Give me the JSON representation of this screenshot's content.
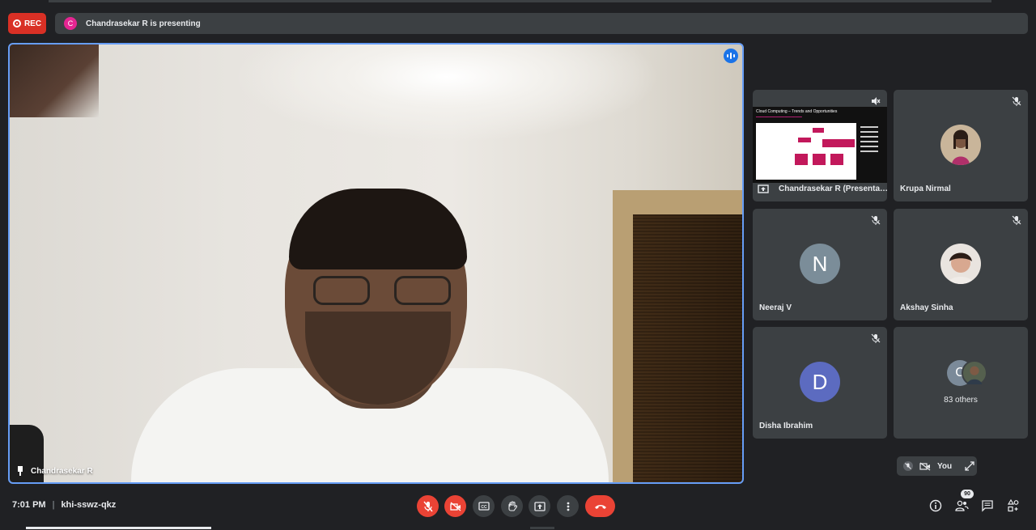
{
  "recording": {
    "label": "REC",
    "color": "#d93025"
  },
  "presenting_bar": {
    "avatar_letter": "C",
    "text": "Chandrasekar R is presenting"
  },
  "main_video": {
    "participant": "Chandrasekar R",
    "speaking": true
  },
  "tiles": [
    {
      "name": "Chandrasekar R (Presenta…",
      "type": "presentation",
      "slide_title": "Cloud Computing – Trends and Opportunities"
    },
    {
      "name": "Krupa Nirmal",
      "type": "photo"
    },
    {
      "name": "Neeraj V",
      "type": "letter",
      "letter": "N",
      "color": "#7b8d99"
    },
    {
      "name": "Akshay Sinha",
      "type": "photo"
    },
    {
      "name": "Disha Ibrahim",
      "type": "letter",
      "letter": "D",
      "color": "#5c6bc0"
    },
    {
      "name": "83 others",
      "type": "others",
      "letter": "C"
    }
  ],
  "self_view": {
    "label": "You"
  },
  "bottom": {
    "time": "7:01 PM",
    "separator": "|",
    "meeting_code": "khi-sswz-qkz",
    "participants_count": "90",
    "controls": [
      "mic-off",
      "camera-off",
      "captions",
      "raise-hand",
      "present",
      "more",
      "hang-up"
    ]
  }
}
